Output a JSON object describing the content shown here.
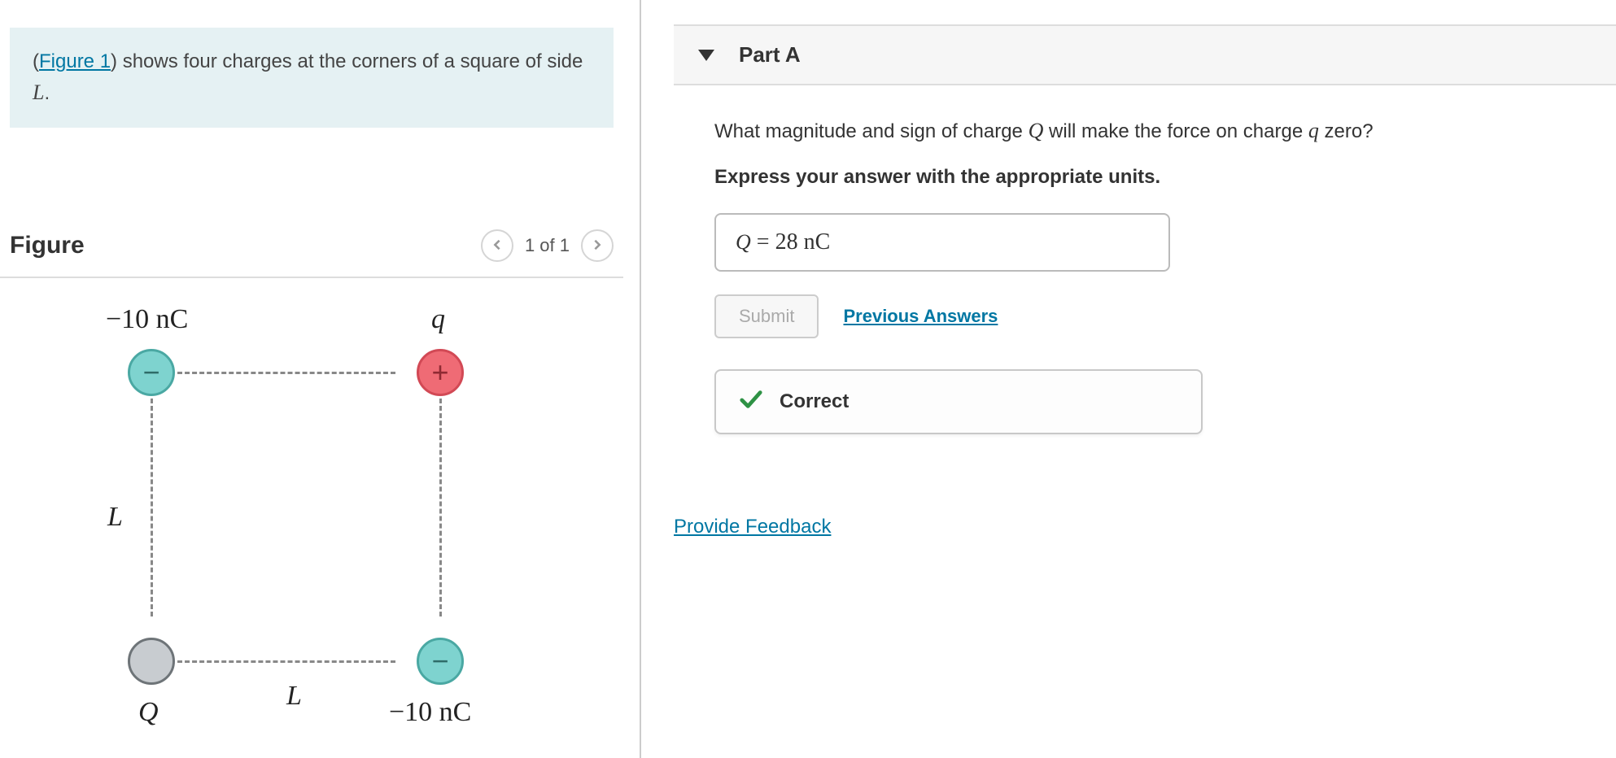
{
  "problem": {
    "figure_link_text": "Figure 1",
    "statement_before": "(",
    "statement_after": ") shows four charges at the corners of a square of side ",
    "side_var": "L",
    "period": "."
  },
  "figure": {
    "title": "Figure",
    "pager_text": "1 of 1",
    "labels": {
      "top_left": "−10 nC",
      "top_right": "q",
      "bottom_left": "Q",
      "bottom_right": "−10 nC",
      "side_left": "L",
      "side_bottom": "L"
    },
    "signs": {
      "top_left": "−",
      "top_right": "+",
      "bottom_right": "−",
      "bottom_left": ""
    }
  },
  "part": {
    "title": "Part A",
    "question_prefix": "What magnitude and sign of charge ",
    "Q_var": "Q",
    "question_mid": " will make the force on charge ",
    "q_var": "q",
    "question_suffix": " zero?",
    "instruction": "Express your answer with the appropriate units.",
    "answer_var": "Q",
    "answer_equals": " = ",
    "answer_value": "28 nC",
    "submit_label": "Submit",
    "previous_answers_label": "Previous Answers",
    "correct_label": "Correct"
  },
  "feedback": {
    "link_text": "Provide Feedback"
  }
}
